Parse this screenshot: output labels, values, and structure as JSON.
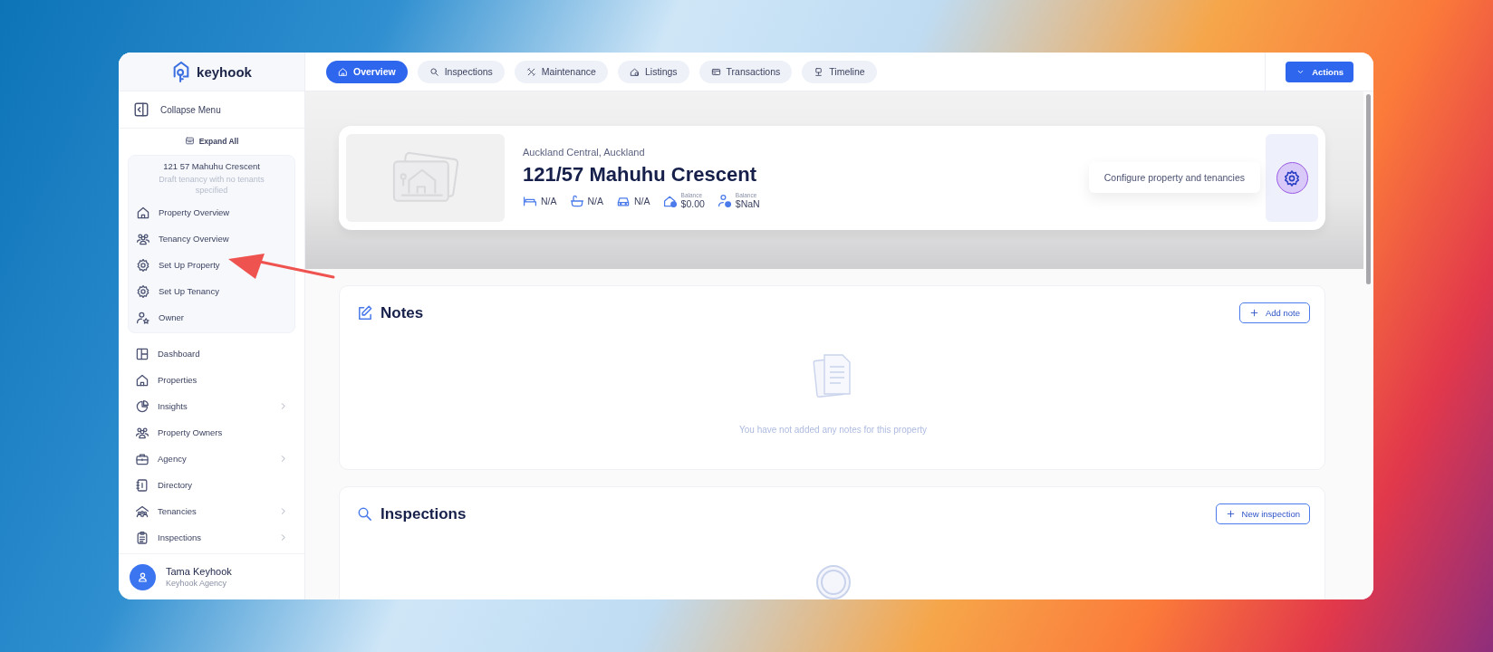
{
  "sidebar": {
    "logo": "keyhook",
    "collapse_label": "Collapse Menu",
    "expand_all": "Expand All",
    "property_panel": {
      "title": "121 57 Mahuhu Crescent",
      "subtitle": "Draft tenancy with no tenants specified",
      "items": [
        {
          "label": "Property Overview"
        },
        {
          "label": "Tenancy Overview"
        },
        {
          "label": "Set Up Property"
        },
        {
          "label": "Set Up Tenancy"
        },
        {
          "label": "Owner"
        }
      ]
    },
    "nav": [
      {
        "label": "Dashboard",
        "expandable": false
      },
      {
        "label": "Properties",
        "expandable": false
      },
      {
        "label": "Insights",
        "expandable": true
      },
      {
        "label": "Property Owners",
        "expandable": false
      },
      {
        "label": "Agency",
        "expandable": true
      },
      {
        "label": "Directory",
        "expandable": false
      },
      {
        "label": "Tenancies",
        "expandable": true
      },
      {
        "label": "Inspections",
        "expandable": true
      }
    ],
    "user": {
      "name": "Tama Keyhook",
      "organisation": "Keyhook Agency"
    }
  },
  "tabs": [
    {
      "label": "Overview",
      "selected": true
    },
    {
      "label": "Inspections",
      "selected": false
    },
    {
      "label": "Maintenance",
      "selected": false
    },
    {
      "label": "Listings",
      "selected": false
    },
    {
      "label": "Transactions",
      "selected": false
    },
    {
      "label": "Timeline",
      "selected": false
    }
  ],
  "actions_button": "Actions",
  "property": {
    "location": "Auckland Central, Auckland",
    "address": "121/57 Mahuhu Crescent",
    "stats": [
      {
        "kind": "bedrooms",
        "value": "N/A"
      },
      {
        "kind": "bathrooms",
        "value": "N/A"
      },
      {
        "kind": "carparks",
        "value": "N/A"
      },
      {
        "kind": "property_balance",
        "label": "Balance",
        "value": "$0.00"
      },
      {
        "kind": "owner_balance",
        "label": "Balance",
        "value": "$NaN"
      }
    ],
    "configure_tooltip": "Configure property and tenancies"
  },
  "sections": [
    {
      "kind": "notes",
      "title": "Notes",
      "button": "Add note",
      "empty_text": "You have not added any notes for this property"
    },
    {
      "kind": "inspections",
      "title": "Inspections",
      "button": "New inspection"
    }
  ]
}
